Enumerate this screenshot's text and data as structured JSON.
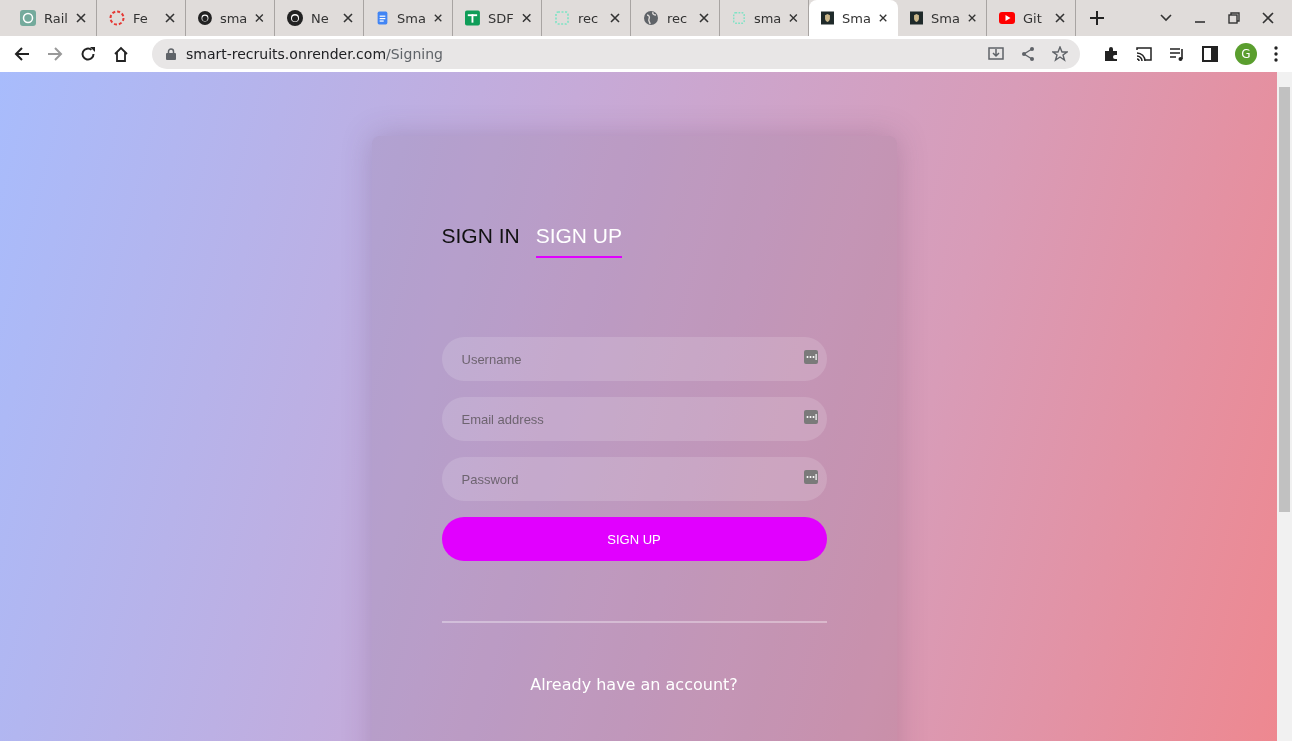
{
  "browser": {
    "tabs": [
      {
        "label": "Rail",
        "kind": "openai",
        "selected": false
      },
      {
        "label": "Fe",
        "kind": "ring",
        "selected": false
      },
      {
        "label": "sma",
        "kind": "github",
        "selected": false
      },
      {
        "label": "Ne",
        "kind": "github",
        "selected": false
      },
      {
        "label": "Sma",
        "kind": "docs",
        "selected": false
      },
      {
        "label": "SDF",
        "kind": "sheets",
        "selected": false
      },
      {
        "label": "rec",
        "kind": "square",
        "selected": false
      },
      {
        "label": "rec",
        "kind": "globe",
        "selected": false
      },
      {
        "label": "sma",
        "kind": "square",
        "selected": false
      },
      {
        "label": "Sma",
        "kind": "shield",
        "selected": true
      },
      {
        "label": "Sma",
        "kind": "shield",
        "selected": false
      },
      {
        "label": "Git",
        "kind": "youtube",
        "selected": false
      }
    ],
    "address": {
      "host": "smart-recruits.onrender.com",
      "path": "/Signing"
    },
    "profile_initial": "G"
  },
  "auth_tabs": [
    {
      "label": "SIGN IN",
      "selected": false
    },
    {
      "label": "SIGN UP",
      "selected": true
    }
  ],
  "fields": [
    {
      "placeholder": "Username"
    },
    {
      "placeholder": "Email address"
    },
    {
      "placeholder": "Password"
    }
  ],
  "submit_button": "SIGN UP",
  "footer_text": "Already have an account?"
}
